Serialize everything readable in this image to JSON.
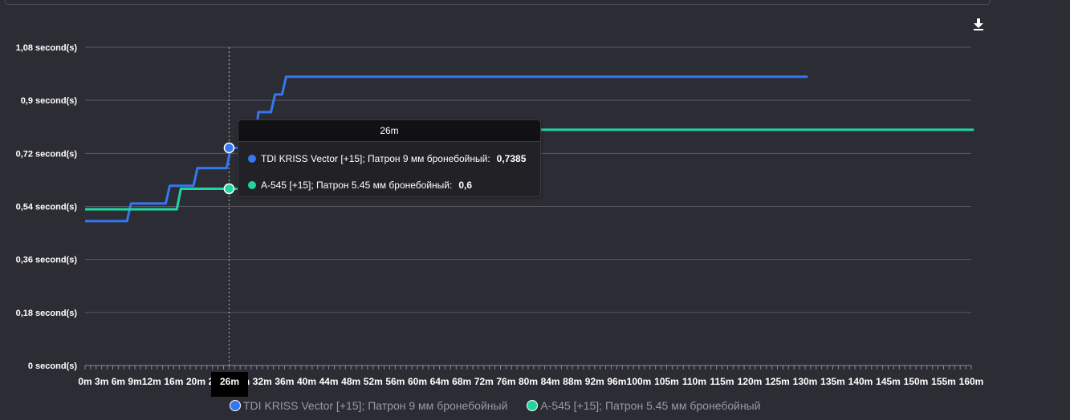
{
  "toolbar": {
    "download_icon": "download-icon"
  },
  "chart_data": {
    "type": "line",
    "step": true,
    "x_categories": [
      "0m",
      "3m",
      "6m",
      "9m",
      "12m",
      "16m",
      "20m",
      "24m",
      "28m",
      "32m",
      "36m",
      "40m",
      "44m",
      "48m",
      "52m",
      "56m",
      "60m",
      "64m",
      "68m",
      "72m",
      "76m",
      "80m",
      "84m",
      "88m",
      "92m",
      "96m",
      "100m",
      "105m",
      "110m",
      "115m",
      "120m",
      "125m",
      "130m",
      "135m",
      "140m",
      "145m",
      "150m",
      "155m",
      "160m"
    ],
    "x_range_minutes": [
      0,
      160
    ],
    "y_range": [
      0,
      1.08
    ],
    "y_ticks": [
      "0 second(s)",
      "0,18 second(s)",
      "0,36 second(s)",
      "0,54 second(s)",
      "0,72 second(s)",
      "0,9 second(s)",
      "1,08 second(s)"
    ],
    "grid": true,
    "legend_position": "bottom",
    "series": [
      {
        "name": "TDI KRISS Vector [+15]; Патрон 9 мм бронебойный",
        "color": "#3478f0",
        "x": [
          0,
          8,
          15,
          20,
          26,
          31,
          34,
          36,
          130
        ],
        "y": [
          0.49,
          0.55,
          0.61,
          0.67,
          0.7385,
          0.86,
          0.92,
          0.98,
          0.98
        ]
      },
      {
        "name": "A-545 [+15]; Патрон 5.45 мм бронебойный",
        "color": "#1fd6a0",
        "x": [
          0,
          17,
          26,
          30,
          49,
          160
        ],
        "y": [
          0.53,
          0.6,
          0.6,
          0.66,
          0.8,
          0.8
        ]
      }
    ],
    "hover": {
      "x_label": "26m",
      "rows": [
        {
          "label": "TDI KRISS Vector [+15]; Патрон 9 мм бронебойный:",
          "value": "0,7385",
          "color": "#3478f0"
        },
        {
          "label": "A-545 [+15]; Патрон 5.45 мм бронебойный:",
          "value": "0,6",
          "color": "#1fd6a0"
        }
      ]
    }
  }
}
